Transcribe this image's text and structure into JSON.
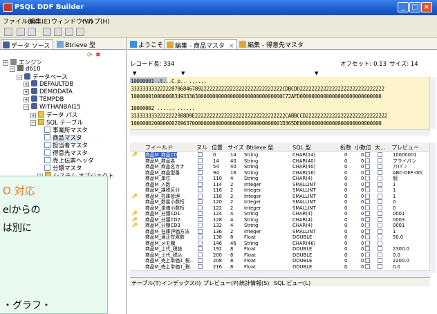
{
  "window": {
    "title": "PSQL DDF Builder",
    "btn_min": "_",
    "btn_max": "□",
    "btn_close": "×"
  },
  "menu": [
    "ファイル(F)",
    "編集(E)",
    "ウィンドウ(W)",
    "ヘルプ(H)"
  ],
  "left": {
    "tabs": [
      "データ ソース",
      "Btrieve 型"
    ],
    "tree": [
      "エンジン",
      "d610",
      "データベース",
      "DEFAULTDB",
      "DEMODATA",
      "TEMPDB",
      "WITHANBAI15",
      "データ パス",
      "SQL テーブル",
      "事業所マスタ",
      "商品マスタ",
      "担当者マスタ",
      "得意先マスタ",
      "売上伝票ヘッダ",
      "分類マスタ",
      "システム オブジェクト"
    ]
  },
  "tabs": [
    "ようこそ",
    "編集 - 商品マスタ",
    "編集 - 得意先マスタ"
  ],
  "record": {
    "length": "レコード長: 334",
    "offset": "オフセット: 0.13",
    "size": "サイズ: 14"
  },
  "hex": {
    "r1a": "10000001          .t...C.p..                        ......",
    "r1b": "3333333332222287868467892222222222222222222222222222CDBCDD22222222222222222222222222222",
    "r1c": "1000000100000083493330300000000000000000000000000000C72AFD0000000000000000000000000000",
    "r2a": "10000002          ......                           ......",
    "r2b": "3333333332222222988D9E2222222222222222222222222222222CABBCCD2222222222222222222222222222",
    "r2c": "1000000200000002696370000000000000000000000000000001D365DE0000000000000000000000000000"
  },
  "grid": {
    "headers": [
      "フィールド",
      "ヌル",
      "位置",
      "サイズ",
      "Btrieve 型",
      "SQL 型",
      "桁数",
      "小数位",
      "大...",
      "プレビュー"
    ],
    "rows": [
      {
        "name": "商品M_商品CD",
        "pos": "0",
        "size": "14",
        "bt": "String",
        "sql": "CHAR(14)",
        "dig": "0",
        "dec": "0",
        "prev": "10000001"
      },
      {
        "name": "商品M_商品名",
        "pos": "14",
        "size": "40",
        "bt": "String",
        "sql": "CHAR(40)",
        "dig": "0",
        "dec": "0",
        "prev": "フライパン"
      },
      {
        "name": "商品M_商品名カナ",
        "pos": "54",
        "size": "40",
        "bt": "String",
        "sql": "CHAR(40)",
        "dig": "0",
        "dec": "0",
        "prev": "ﾌﾗｲﾊﾟﾝ"
      },
      {
        "name": "商品M_商品型番",
        "pos": "94",
        "size": "16",
        "bt": "String",
        "sql": "CHAR(16)",
        "dig": "0",
        "dec": "0",
        "prev": "ABC-DEF-00("
      },
      {
        "name": "商品M_単位",
        "pos": "110",
        "size": "4",
        "bt": "String",
        "sql": "CHAR(4)",
        "dig": "0",
        "dec": "0",
        "prev": "個"
      },
      {
        "name": "商品M_入数",
        "pos": "114",
        "size": "2",
        "bt": "Integer",
        "sql": "SMALLINT",
        "dig": "0",
        "dec": "0",
        "prev": "1"
      },
      {
        "name": "商品M_課税区分",
        "pos": "116",
        "size": "2",
        "bt": "Integer",
        "sql": "SMALLINT",
        "dig": "0",
        "dec": "0",
        "prev": "1"
      },
      {
        "name": "商品M_在庫管理",
        "pos": "118",
        "size": "2",
        "bt": "Integer",
        "sql": "SMALLINT",
        "dig": "0",
        "dec": "0",
        "prev": "1"
      },
      {
        "name": "商品M_数量小数桁",
        "pos": "120",
        "size": "2",
        "bt": "Integer",
        "sql": "SMALLINT",
        "dig": "0",
        "dec": "0",
        "prev": "0"
      },
      {
        "name": "商品M_単価小数桁",
        "pos": "122",
        "size": "2",
        "bt": "Integer",
        "sql": "SMALLINT",
        "dig": "0",
        "dec": "0",
        "prev": "0"
      },
      {
        "name": "商品M_分類CD1",
        "pos": "124",
        "size": "4",
        "bt": "String",
        "sql": "CHAR(4)",
        "dig": "0",
        "dec": "0",
        "prev": "0001"
      },
      {
        "name": "商品M_分類CD2",
        "pos": "128",
        "size": "4",
        "bt": "String",
        "sql": "CHAR(4)",
        "dig": "0",
        "dec": "0",
        "prev": "0003"
      },
      {
        "name": "商品M_分類CD3",
        "pos": "132",
        "size": "4",
        "bt": "String",
        "sql": "CHAR(4)",
        "dig": "0",
        "dec": "0",
        "prev": "0001"
      },
      {
        "name": "商品M_在庫評価方法",
        "pos": "136",
        "size": "2",
        "bt": "Integer",
        "sql": "SMALLINT",
        "dig": "0",
        "dec": "0",
        "prev": "1"
      },
      {
        "name": "商品M_適正在庫数",
        "pos": "138",
        "size": "8",
        "bt": "Float",
        "sql": "DOUBLE",
        "dig": "0",
        "dec": "0",
        "prev": "50.0"
      },
      {
        "name": "商品M_メモ欄",
        "pos": "146",
        "size": "46",
        "bt": "String",
        "sql": "CHAR(46)",
        "dig": "0",
        "dec": "0",
        "prev": ""
      },
      {
        "name": "商品M_上代_税抜",
        "pos": "192",
        "size": "8",
        "bt": "Float",
        "sql": "DOUBLE",
        "dig": "0",
        "dec": "0",
        "prev": "2300.0"
      },
      {
        "name": "商品M_上代_税込",
        "pos": "200",
        "size": "8",
        "bt": "Float",
        "sql": "DOUBLE",
        "dig": "0",
        "dec": "0",
        "prev": "0.0"
      },
      {
        "name": "商品M_売上単価1_税...",
        "pos": "208",
        "size": "8",
        "bt": "Float",
        "sql": "DOUBLE",
        "dig": "0",
        "dec": "0",
        "prev": "2200.0"
      },
      {
        "name": "商品M_売上単価1_税...",
        "pos": "216",
        "size": "8",
        "bt": "Float",
        "sql": "DOUBLE",
        "dig": "0",
        "dec": "0",
        "prev": "0.0"
      }
    ]
  },
  "bottom_tabs": [
    "テーブル(T)",
    "インデックス(I)",
    "プレビュー(P)",
    "統計情報(S)",
    "SQL ビュー(L)"
  ],
  "overlay": [
    "O 対応",
    "elからの",
    "は別に",
    "・グラフ・"
  ],
  "colors": {
    "hex_bg": "#fdf3c9",
    "selected": "#2f5fc7",
    "overlay_accent": "#e87722"
  }
}
